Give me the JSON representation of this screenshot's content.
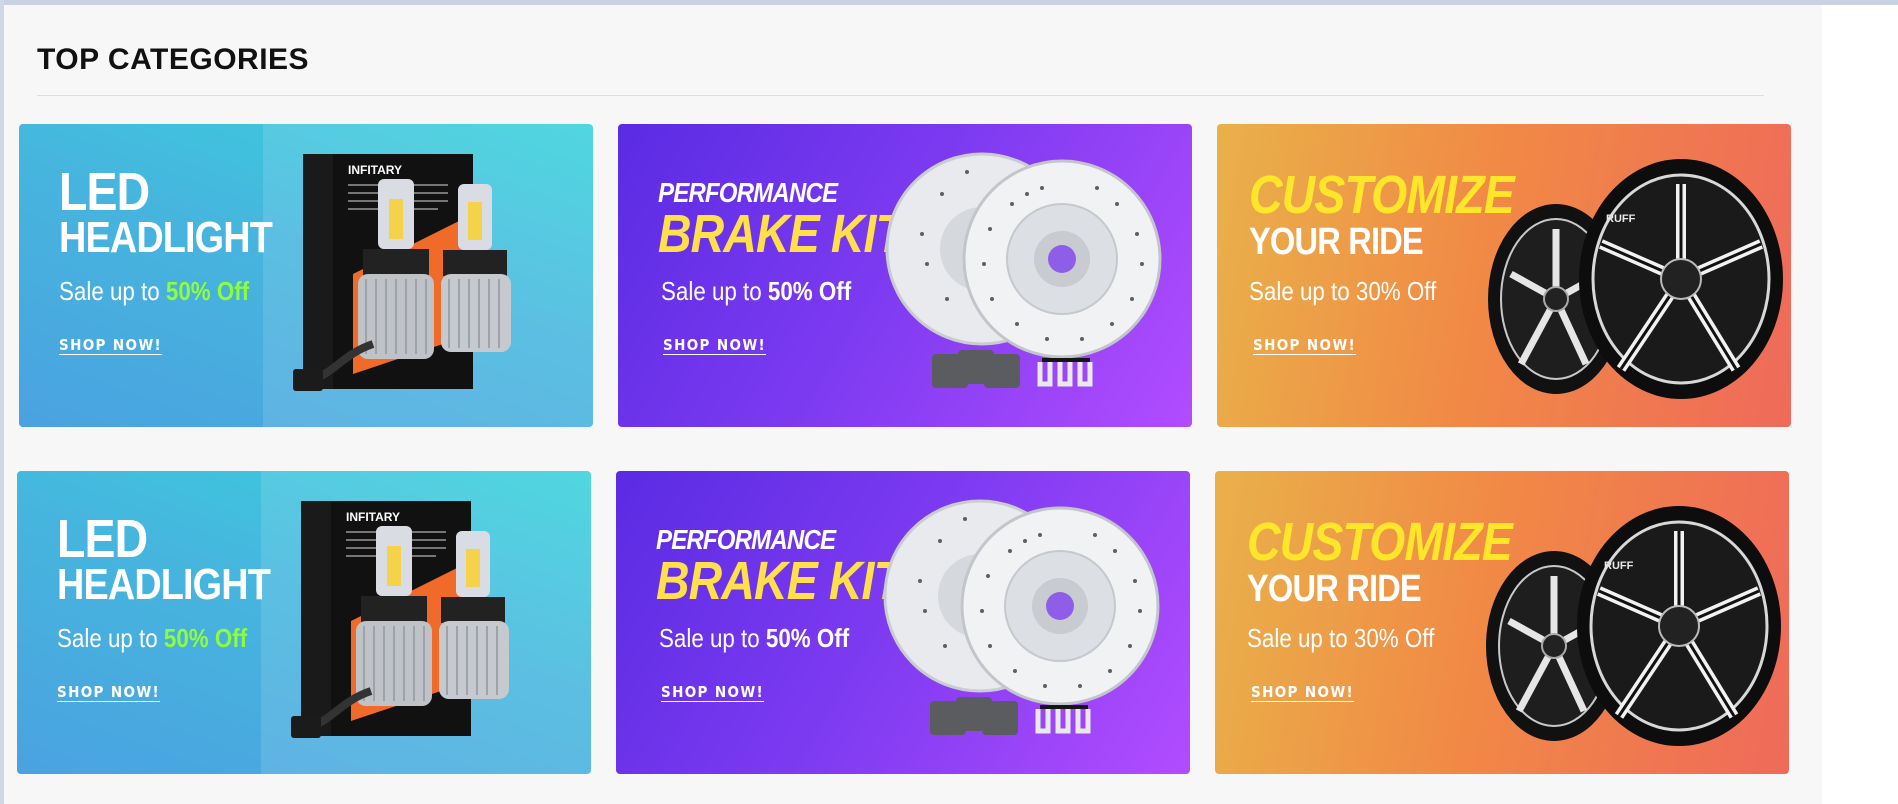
{
  "section": {
    "title": "TOP CATEGORIES"
  },
  "banners": [
    {
      "kind": "led",
      "headline_1": "LED",
      "headline_2": "HEADLIGHT",
      "sale_prefix": "Sale up to",
      "sale_value": "50% Off",
      "shop_label": "SHOP NOW!",
      "product_brand": "INFITARY",
      "accent": "#8cff3c"
    },
    {
      "kind": "brake",
      "headline_1": "PERFORMANCE",
      "headline_2": "BRAKE KITS",
      "sale_prefix": "Sale up to",
      "sale_value": "50% Off",
      "shop_label": "SHOP NOW!",
      "accent": "#ffe04a"
    },
    {
      "kind": "wheel",
      "headline_1": "CUSTOMIZE",
      "headline_2": "YOUR RIDE",
      "sale_prefix": "Sale up to",
      "sale_value": "30% Off",
      "shop_label": "SHOP NOW!",
      "wheel_brand": "RUFF",
      "accent": "#ffe62a"
    }
  ]
}
